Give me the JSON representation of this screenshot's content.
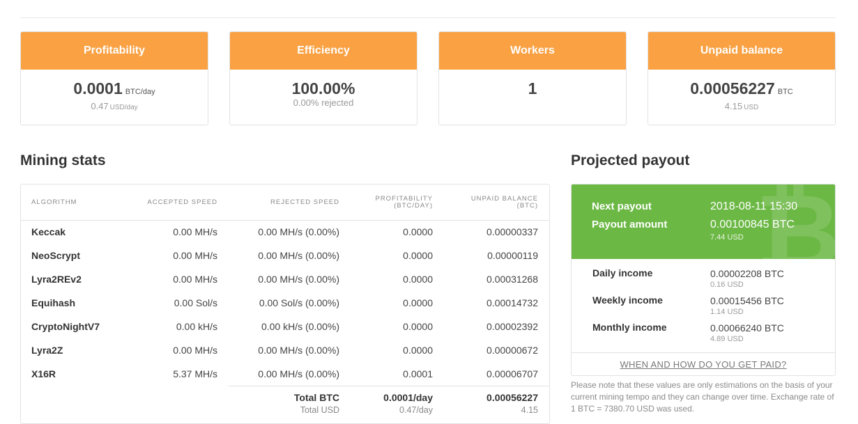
{
  "cards": [
    {
      "title": "Profitability",
      "main": "0.0001",
      "main_unit": "BTC/day",
      "sub": "0.47",
      "sub_unit": "USD/day"
    },
    {
      "title": "Efficiency",
      "main": "100.00%",
      "main_unit": "",
      "sub": "0.00% rejected",
      "sub_unit": ""
    },
    {
      "title": "Workers",
      "main": "1",
      "main_unit": "",
      "sub": "",
      "sub_unit": ""
    },
    {
      "title": "Unpaid balance",
      "main": "0.00056227",
      "main_unit": "BTC",
      "sub": "4.15",
      "sub_unit": "USD"
    }
  ],
  "mining_stats": {
    "title": "Mining stats",
    "headers": {
      "algorithm": "ALGORITHM",
      "accepted": "ACCEPTED SPEED",
      "rejected": "REJECTED SPEED",
      "profitability_1": "PROFITABILITY",
      "profitability_2": "(BTC/DAY)",
      "unpaid_1": "UNPAID BALANCE",
      "unpaid_2": "(BTC)"
    },
    "rows": [
      {
        "algorithm": "Keccak",
        "accepted": "0.00 MH/s",
        "rejected": "0.00 MH/s (0.00%)",
        "profitability": "0.0000",
        "unpaid": "0.00000337"
      },
      {
        "algorithm": "NeoScrypt",
        "accepted": "0.00 MH/s",
        "rejected": "0.00 MH/s (0.00%)",
        "profitability": "0.0000",
        "unpaid": "0.00000119"
      },
      {
        "algorithm": "Lyra2REv2",
        "accepted": "0.00 MH/s",
        "rejected": "0.00 MH/s (0.00%)",
        "profitability": "0.0000",
        "unpaid": "0.00031268"
      },
      {
        "algorithm": "Equihash",
        "accepted": "0.00 Sol/s",
        "rejected": "0.00 Sol/s (0.00%)",
        "profitability": "0.0000",
        "unpaid": "0.00014732"
      },
      {
        "algorithm": "CryptoNightV7",
        "accepted": "0.00 kH/s",
        "rejected": "0.00 kH/s (0.00%)",
        "profitability": "0.0000",
        "unpaid": "0.00002392"
      },
      {
        "algorithm": "Lyra2Z",
        "accepted": "0.00 MH/s",
        "rejected": "0.00 MH/s (0.00%)",
        "profitability": "0.0000",
        "unpaid": "0.00000672"
      },
      {
        "algorithm": "X16R",
        "accepted": "5.37 MH/s",
        "rejected": "0.00 MH/s (0.00%)",
        "profitability": "0.0001",
        "unpaid": "0.00006707"
      }
    ],
    "totals": {
      "btc_label": "Total BTC",
      "btc_profitability": "0.0001/day",
      "btc_unpaid": "0.00056227",
      "usd_label": "Total USD",
      "usd_profitability": "0.47/day",
      "usd_unpaid": "4.15"
    }
  },
  "projected_payout": {
    "title": "Projected payout",
    "btc_icon": "bitcoin-icon",
    "next_payout_label": "Next payout",
    "next_payout_value": "2018-08-11 15:30",
    "payout_amount_label": "Payout amount",
    "payout_amount_value": "0.00100845 BTC",
    "payout_amount_usd": "7.44 USD",
    "incomes": [
      {
        "label": "Daily income",
        "btc": "0.00002208 BTC",
        "usd": "0.16 USD"
      },
      {
        "label": "Weekly income",
        "btc": "0.00015456 BTC",
        "usd": "1.14 USD"
      },
      {
        "label": "Monthly income",
        "btc": "0.00066240 BTC",
        "usd": "4.89 USD"
      }
    ],
    "paid_link": "WHEN AND HOW DO YOU GET PAID?"
  },
  "note": "Please note that these values are only estimations on the basis of your current mining tempo and they can change over time. Exchange rate of 1 BTC = 7380.70 USD was used.",
  "colors": {
    "orange": "#f9a143",
    "green": "#6cb845"
  }
}
